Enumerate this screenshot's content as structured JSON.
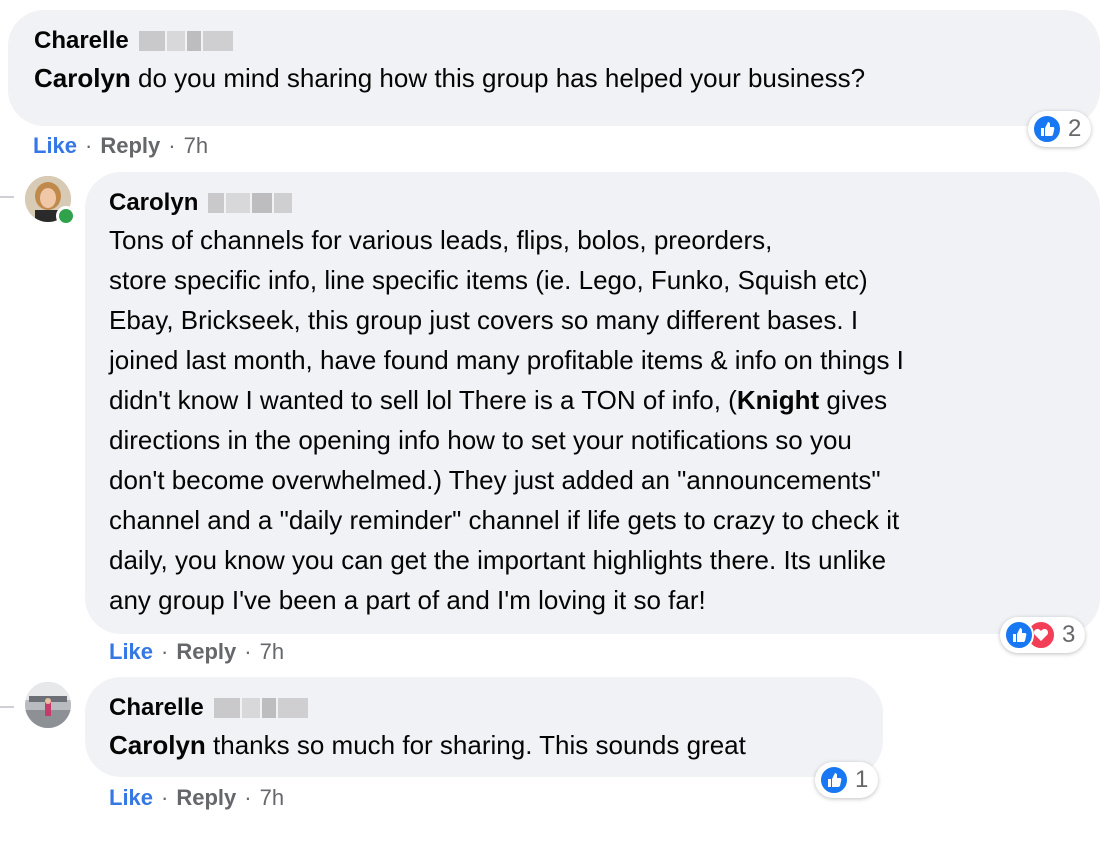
{
  "comments": [
    {
      "author": "Charelle",
      "mention": "Carolyn",
      "text": " do you mind sharing how this group has helped your business?",
      "actions": {
        "like": "Like",
        "reply": "Reply",
        "time": "7h",
        "sep": "·"
      },
      "reactions": {
        "count": "2",
        "icons": [
          "like-icon"
        ]
      }
    },
    {
      "author": "Carolyn",
      "lines": [
        "Tons of channels for various leads, flips, bolos, preorders,",
        "store specific info, line specific items (ie. Lego, Funko, Squish etc)",
        "Ebay, Brickseek, this group just covers so many different bases. I",
        "joined last month, have found many profitable items & info on things I",
        "didn't know I wanted to sell lol There is a TON of info, (",
        "directions in the opening info how to set your notifications so you",
        "don't become overwhelmed.) They just added an \"announcements\"",
        "channel and a \"daily reminder\" channel if life gets to crazy to check it",
        "daily, you know you can get the important highlights there. Its unlike",
        "any group I've been a part of and I'm loving it so far!"
      ],
      "mention": "Knight",
      "after_mention": " gives",
      "actions": {
        "like": "Like",
        "reply": "Reply",
        "time": "7h",
        "sep": "·"
      },
      "reactions": {
        "count": "3",
        "icons": [
          "like-icon",
          "love-icon"
        ]
      }
    },
    {
      "author": "Charelle",
      "mention": "Carolyn",
      "text": " thanks so much for sharing. This sounds great",
      "actions": {
        "like": "Like",
        "reply": "Reply",
        "time": "7h",
        "sep": "·"
      },
      "reactions": {
        "count": "1",
        "icons": [
          "like-icon"
        ]
      }
    }
  ],
  "colors": {
    "bubble": "#f0f2f5",
    "like_blue": "#3578e5",
    "love_red": "#f33e58",
    "online_green": "#31a24c",
    "meta_gray": "#65676b"
  }
}
